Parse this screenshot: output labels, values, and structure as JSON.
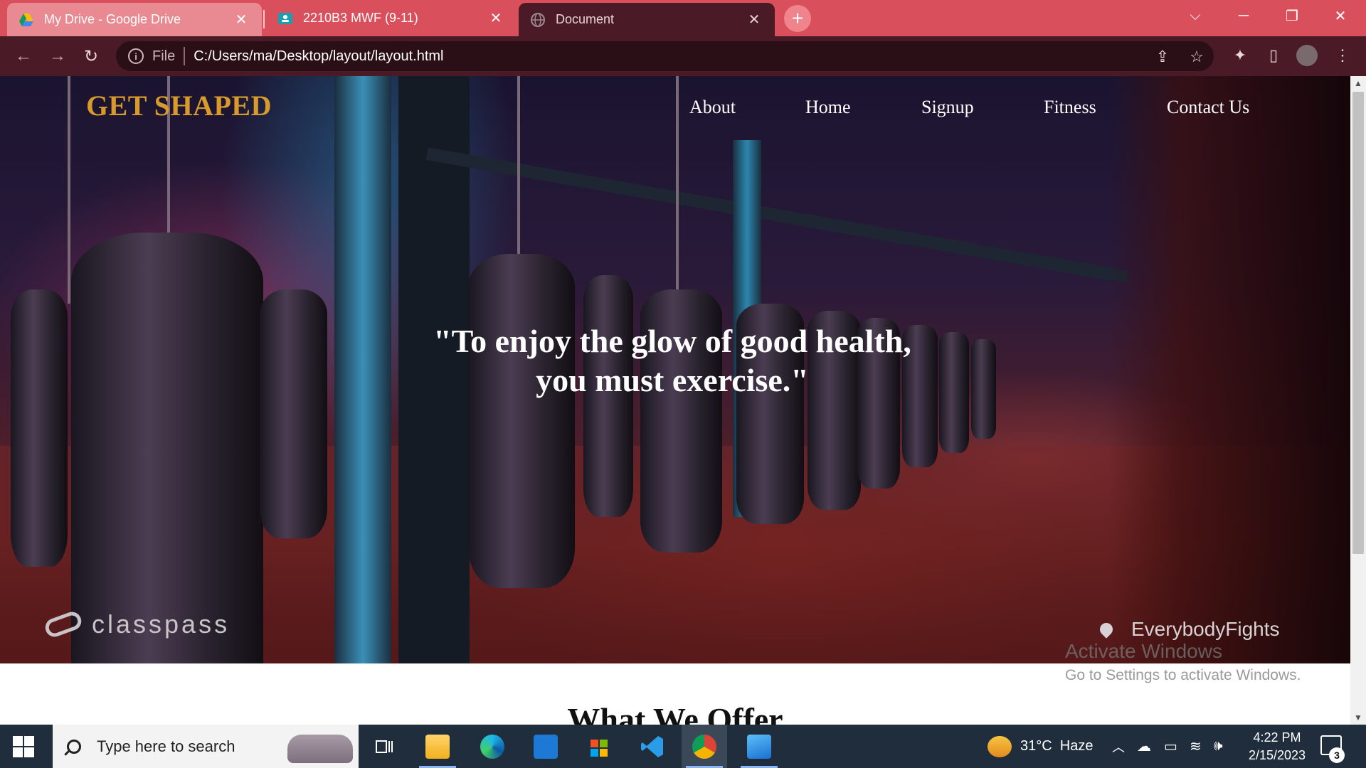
{
  "browser": {
    "tabs": [
      {
        "title": "My Drive - Google Drive",
        "icon": "google-drive-icon"
      },
      {
        "title": "2210B3 MWF (9-11)",
        "icon": "classroom-icon"
      },
      {
        "title": "Document",
        "icon": "globe-icon"
      }
    ],
    "new_tab_label": "+",
    "address": {
      "scheme_label": "File",
      "url": "C:/Users/ma/Desktop/layout/layout.html"
    },
    "accent_color": "#d9505c"
  },
  "site": {
    "brand": "GET SHAPED",
    "brand_color": "#d99a2b",
    "nav": [
      "About",
      "Home",
      "Signup",
      "Fitness",
      "Contact Us"
    ],
    "quote_line1": "\"To enjoy the glow of good health,",
    "quote_line2": "you must exercise.\"",
    "watermark_left": "classpass",
    "watermark_right": "EverybodyFights",
    "section_title": "What We Offer"
  },
  "windows_overlay": {
    "title": "Activate Windows",
    "subtitle": "Go to Settings to activate Windows."
  },
  "taskbar": {
    "search_placeholder": "Type here to search",
    "weather": "31°C  Haze",
    "time": "4:22 PM",
    "date": "2/15/2023",
    "notification_count": "3"
  }
}
